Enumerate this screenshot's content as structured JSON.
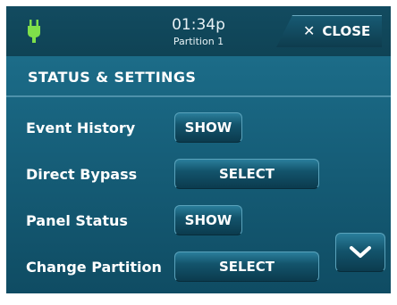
{
  "header": {
    "time": "01:34p",
    "partition": "Partition 1",
    "close_label": "CLOSE",
    "close_icon": "x-icon",
    "power_icon": "plug-icon",
    "power_color": "#7fe04a"
  },
  "section": {
    "title": "STATUS & SETTINGS"
  },
  "rows": [
    {
      "label": "Event History",
      "button": "SHOW"
    },
    {
      "label": "Direct  Bypass",
      "button": "SELECT"
    },
    {
      "label": "Panel  Status",
      "button": "SHOW"
    },
    {
      "label": "Change Partition",
      "button": "SELECT"
    }
  ],
  "scroll": {
    "icon": "chevron-down-icon"
  },
  "colors": {
    "background": "#17617c",
    "accent": "#5aa2bb"
  }
}
